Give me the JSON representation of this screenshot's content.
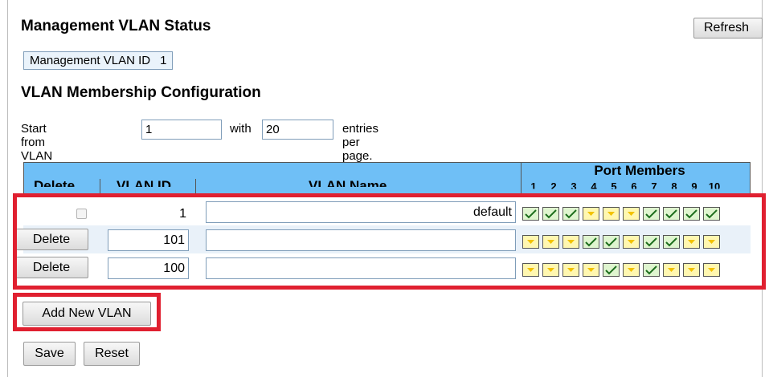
{
  "status": {
    "title": "Management VLAN Status",
    "refresh_label": "Refresh",
    "mgmt_label": "Management VLAN ID",
    "mgmt_value": "1"
  },
  "membership": {
    "title": "VLAN Membership Configuration",
    "start_label": "Start from VLAN",
    "start_value": "1",
    "with_label": "with",
    "entries_value": "20",
    "per_page_label": "entries per page."
  },
  "table": {
    "headers": {
      "delete": "Delete",
      "vlan_id": "VLAN ID",
      "vlan_name": "VLAN Name",
      "port_members": "Port Members"
    },
    "ports": [
      "1",
      "2",
      "3",
      "4",
      "5",
      "6",
      "7",
      "8",
      "9",
      "10"
    ],
    "rows": [
      {
        "delete": null,
        "vlan_id": "1",
        "name": "default",
        "members": [
          true,
          true,
          true,
          false,
          false,
          false,
          true,
          true,
          true,
          true
        ]
      },
      {
        "delete": "Delete",
        "vlan_id": "101",
        "name": "",
        "members": [
          false,
          false,
          false,
          true,
          true,
          false,
          true,
          true,
          false,
          false
        ]
      },
      {
        "delete": "Delete",
        "vlan_id": "100",
        "name": "",
        "members": [
          false,
          false,
          false,
          false,
          true,
          false,
          true,
          false,
          false,
          false
        ]
      }
    ]
  },
  "actions": {
    "add_label": "Add New VLAN",
    "save_label": "Save",
    "reset_label": "Reset"
  },
  "colors": {
    "header_bg": "#6fbff6",
    "member_on": "#dff5cf",
    "member_off": "#fff7b0",
    "highlight": "#e02030"
  }
}
